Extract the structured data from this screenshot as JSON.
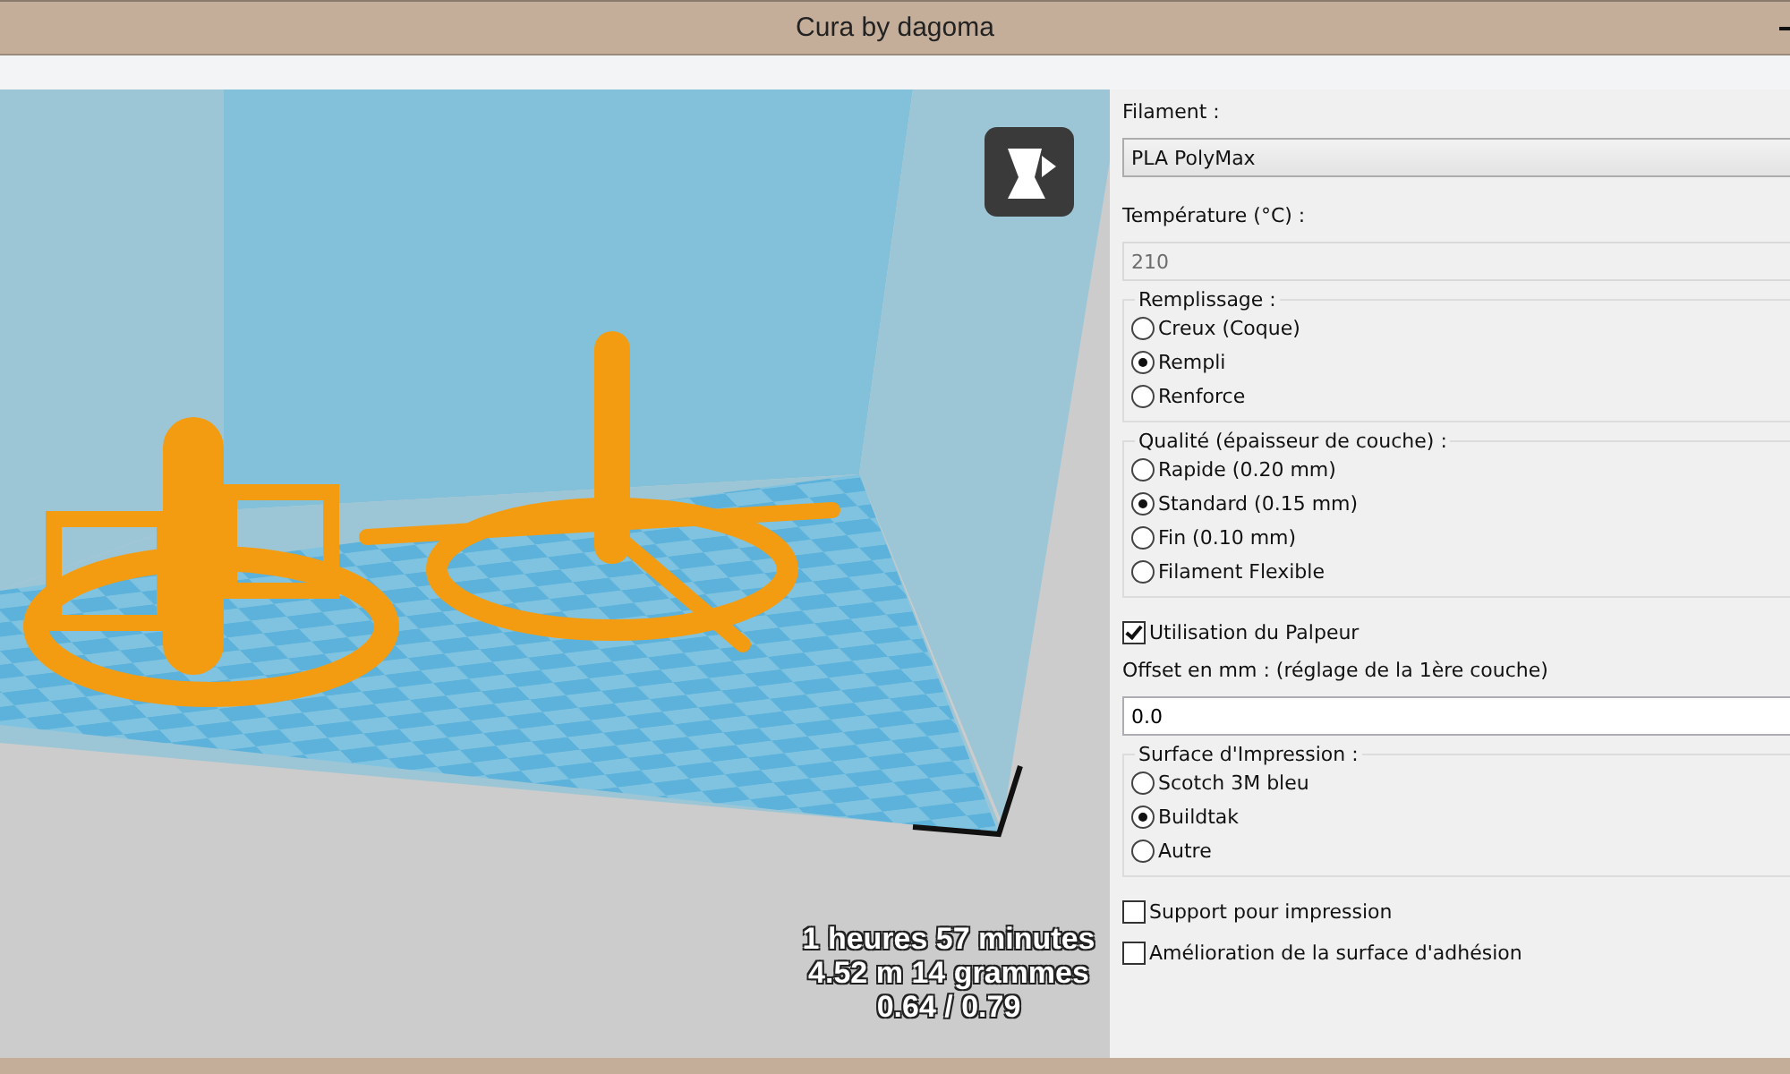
{
  "window": {
    "title": "Cura by dagoma"
  },
  "viewport": {
    "stats": [
      "1 heures 57 minutes",
      "4.52 m 14 grammes",
      "0.64 / 0.79"
    ]
  },
  "settings": [
    {
      "kind": "label",
      "text": "Filament :"
    },
    {
      "kind": "select",
      "value": "PLA PolyMax"
    },
    {
      "kind": "label",
      "text": "Température (°C) :"
    },
    {
      "kind": "field",
      "value": "210",
      "disabled": true
    },
    {
      "kind": "group",
      "title": "Remplissage :",
      "options": [
        {
          "label": "Creux (Coque)",
          "selected": false
        },
        {
          "label": "Rempli",
          "selected": true
        },
        {
          "label": "Renforce",
          "selected": false
        }
      ]
    },
    {
      "kind": "group",
      "title": "Qualité (épaisseur de couche) :",
      "options": [
        {
          "label": "Rapide (0.20 mm)",
          "selected": false
        },
        {
          "label": "Standard (0.15 mm)",
          "selected": true
        },
        {
          "label": "Fin (0.10 mm)",
          "selected": false
        },
        {
          "label": "Filament Flexible",
          "selected": false
        }
      ]
    },
    {
      "kind": "checkbox",
      "label": "Utilisation du Palpeur",
      "checked": true
    },
    {
      "kind": "label",
      "text": "Offset en mm : (réglage de la 1ère couche)"
    },
    {
      "kind": "field",
      "value": "0.0",
      "disabled": false
    },
    {
      "kind": "group",
      "title": "Surface d'Impression :",
      "options": [
        {
          "label": "Scotch 3M bleu",
          "selected": false
        },
        {
          "label": "Buildtak",
          "selected": true
        },
        {
          "label": "Autre",
          "selected": false
        }
      ]
    },
    {
      "kind": "checkbox",
      "label": "Support pour impression",
      "checked": false
    },
    {
      "kind": "checkbox",
      "label": "Amélioration de la surface d'adhésion",
      "checked": false
    }
  ]
}
